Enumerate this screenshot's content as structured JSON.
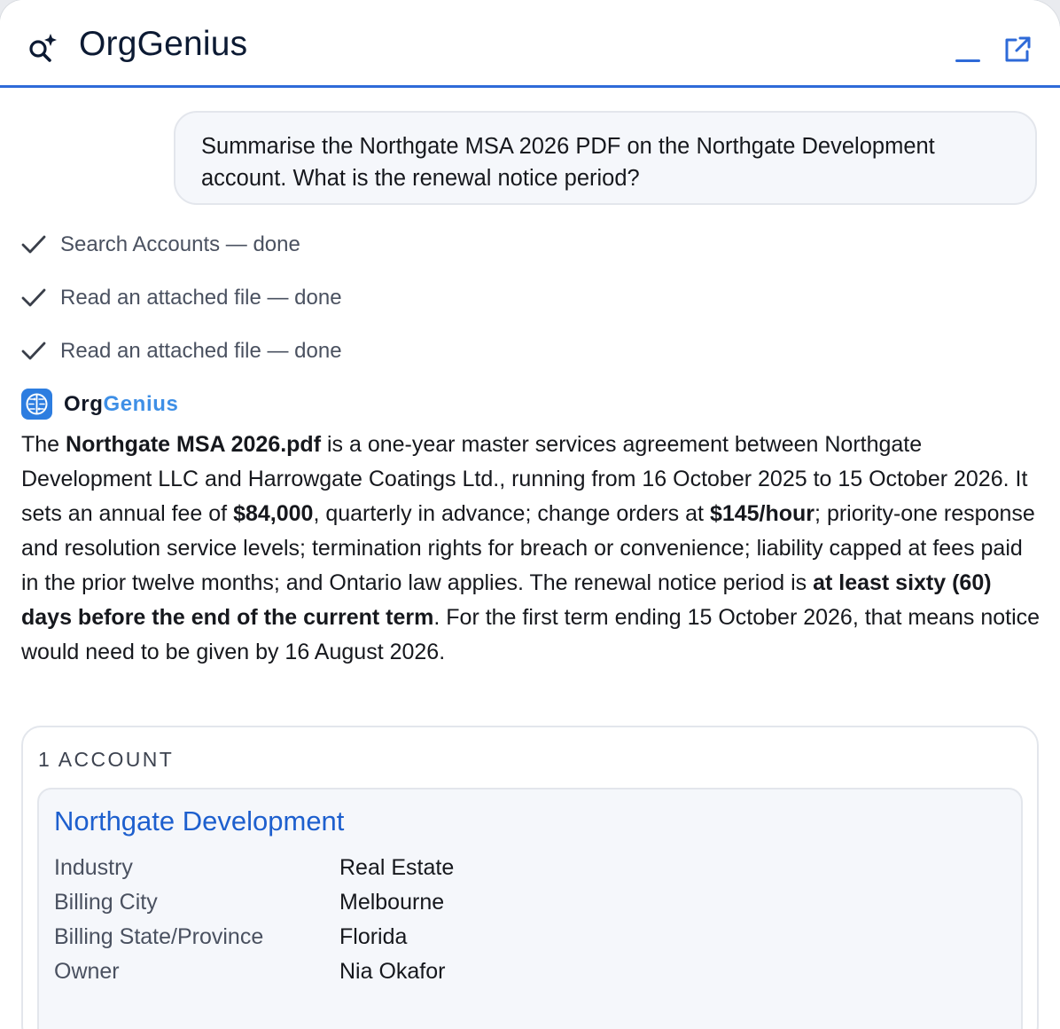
{
  "header": {
    "title": "OrgGenius",
    "icons": {
      "brand": "search-sparkle-icon",
      "minimize": "minimize-icon",
      "popout": "external-link-icon"
    }
  },
  "user_message": "Summarise the Northgate MSA 2026 PDF on the Northgate Development account. What is the renewal notice period?",
  "steps": [
    {
      "label": "Search Accounts — done",
      "icon": "checkmark-icon"
    },
    {
      "label": "Read an attached file — done",
      "icon": "checkmark-icon"
    },
    {
      "label": "Read an attached file — done",
      "icon": "checkmark-icon"
    }
  ],
  "assistant": {
    "name_part1": "Org",
    "name_part2": "Genius",
    "avatar_icon": "brain-icon",
    "answer": {
      "t1": "The ",
      "b1": "Northgate MSA 2026.pdf",
      "t2": " is a one-year master services agreement between Northgate Development LLC and Harrowgate Coatings Ltd., running from 16 October 2025 to 15 October 2026. It sets an annual fee of ",
      "b2": "$84,000",
      "t3": ", quarterly in advance; change orders at ",
      "b3": "$145/hour",
      "t4": "; priority-one response and resolution service levels; termination rights for breach or convenience; liability capped at fees paid in the prior twelve months; and Ontario law applies. The renewal notice period is ",
      "b4": "at least sixty (60) days before the end of the current term",
      "t5": ". For the first term ending 15 October 2026, that means notice would need to be given by 16 August 2026."
    }
  },
  "results": {
    "count_label": "1 ACCOUNT",
    "account": {
      "name": "Northgate Development",
      "fields": [
        {
          "label": "Industry",
          "value": "Real Estate"
        },
        {
          "label": "Billing City",
          "value": "Melbourne"
        },
        {
          "label": "Billing State/Province",
          "value": "Florida"
        },
        {
          "label": "Owner",
          "value": "Nia Okafor"
        }
      ]
    }
  },
  "colors": {
    "accent": "#2e6ad8",
    "link": "#1d5fce",
    "brand_light": "#3e8fe6"
  }
}
